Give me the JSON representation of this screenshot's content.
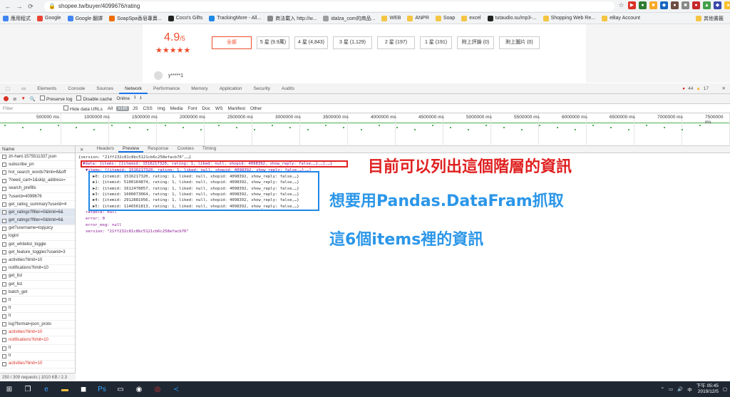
{
  "browser": {
    "url": "shopee.tw/buyer/4099676/rating",
    "bookmarks": [
      "應用程式",
      "Google",
      "Google 翻譯",
      "SoapSpa香皂專賣...",
      "Coco's Gifts",
      "TrackingMore - All...",
      "商法載入 http://w...",
      "idalza_com的商品...",
      "WEB",
      "ANPR",
      "Soap",
      "excel",
      "tutaudio.su/mp3-...",
      "Shopping Web Re...",
      "eBay Account",
      "其他書籤"
    ]
  },
  "page": {
    "score": "4.9",
    "score_suffix": "/5",
    "stars": "★★★★★",
    "filters": [
      "全部",
      "5 星 (9.9萬)",
      "4 星 (4,843)",
      "3 星 (1,129)",
      "2 星 (197)",
      "1 星 (191)",
      "附上評論 (0)",
      "附上圖片 (0)"
    ],
    "reviewer": "y*****1",
    "chat_label": "聊聊"
  },
  "devtools": {
    "tabs": [
      "Elements",
      "Console",
      "Sources",
      "Network",
      "Performance",
      "Memory",
      "Application",
      "Security",
      "Audits"
    ],
    "active_tab": "Network",
    "errors": "44",
    "warnings": "17",
    "toolbar": {
      "preserve_log": "Preserve log",
      "disable_cache": "Disable cache",
      "online": "Online"
    },
    "filter": {
      "placeholder": "Filter",
      "hide_data_urls": "Hide data URLs",
      "types": [
        "All",
        "XHR",
        "JS",
        "CSS",
        "Img",
        "Media",
        "Font",
        "Doc",
        "WS",
        "Manifest",
        "Other"
      ]
    },
    "timeline_ticks": [
      "500000 ms",
      "1000000 ms",
      "1500000 ms",
      "2000000 ms",
      "2500000 ms",
      "3000000 ms",
      "3500000 ms",
      "4000000 ms",
      "4500000 ms",
      "5000000 ms",
      "5500000 ms",
      "6000000 ms",
      "6500000 ms",
      "7000000 ms",
      "7500000 ms"
    ],
    "requests_header": "Name",
    "requests": [
      {
        "name": "zh-hant.1575511337.json",
        "red": false
      },
      {
        "name": "subscribe_pn",
        "red": false
      },
      {
        "name": "hot_search_words?limit=8&off",
        "red": false
      },
      {
        "name": "?need_cart=1&skip_address=",
        "red": false
      },
      {
        "name": "search_prefills",
        "red": false
      },
      {
        "name": "?userid=4099676",
        "red": false
      },
      {
        "name": "get_rating_summary?userid=4",
        "red": false
      },
      {
        "name": "get_ratings?filter=0&limit=6&",
        "red": false
      },
      {
        "name": "get_ratings?filter=0&limit=6&",
        "red": false
      },
      {
        "name": "get?username=topjuicy",
        "red": false
      },
      {
        "name": "login/",
        "red": false
      },
      {
        "name": "get_whitelist_toggle",
        "red": false
      },
      {
        "name": "get_feature_toggles?userid=3",
        "red": false
      },
      {
        "name": "activities?limit=10",
        "red": false
      },
      {
        "name": "notifications?limit=10",
        "red": false
      },
      {
        "name": "get_list",
        "red": false
      },
      {
        "name": "get_list",
        "red": false
      },
      {
        "name": "batch_get",
        "red": false
      },
      {
        "name": "tr",
        "red": false
      },
      {
        "name": "tr",
        "red": false
      },
      {
        "name": "tr",
        "red": false
      },
      {
        "name": "log?format=json_proto",
        "red": false
      },
      {
        "name": "activities?limit=10",
        "red": true
      },
      {
        "name": "notifications?limit=10",
        "red": true
      },
      {
        "name": "tr",
        "red": false
      },
      {
        "name": "tr",
        "red": false
      },
      {
        "name": "activities?limit=10",
        "red": true
      }
    ],
    "status": "250 / 309 requests  |  1010 KB / 2.3",
    "detail_tabs": [
      "Headers",
      "Preview",
      "Response",
      "Cookies",
      "Timing"
    ],
    "preview": {
      "line0": "{version: \"21ff232c81c8bc5121cb6c258efacb76\",…}",
      "line1": "▼data: {items: [{itemid: 1516217320, rating: 1, liked: null, shopid: 4098392, show_reply: false,…},…],…}",
      "line2": "  ▼items: [{itemid: 1516217320, rating: 1, liked: null, shopid: 4098392, show_reply: false,…},…]",
      "items": [
        "▶0: {itemid: 1516217320, rating: 1, liked: null, shopid: 4098392, show_reply: false,…}",
        "▶1: {itemid: 5100164874, rating: 1, liked: null, shopid: 4098392, show_reply: false,…}",
        "▶2: {itemid: 1612478857, rating: 1, liked: null, shopid: 4098392, show_reply: false,…}",
        "▶3: {itemid: 1600073064, rating: 1, liked: null, shopid: 4098392, show_reply: false,…}",
        "▶4: {itemid: 2912881956, rating: 1, liked: null, shopid: 4098392, show_reply: false,…}",
        "▶5: {itemid: 1146561813, rating: 1, liked: null, shopid: 4098392, show_reply: false,…}"
      ],
      "ratable": "ratable: null",
      "error": "error: 0",
      "error_msg": "error_msg: null",
      "version": "version: \"21ff232c81c8bc5121cb6c258efacb76\""
    }
  },
  "annotations": {
    "red": "目前可以列出這個階層的資訊",
    "blue1": "想要用Pandas.DataFram抓取",
    "blue2": "這6個items裡的資訊"
  },
  "taskbar": {
    "time": "下午 05:45",
    "date": "2019/12/5",
    "lang": "中"
  },
  "colors": {
    "shopee": "#ee4d2d",
    "annotation_red": "#e02020",
    "annotation_blue": "#2b96e8",
    "chat": "#00bfa5"
  }
}
